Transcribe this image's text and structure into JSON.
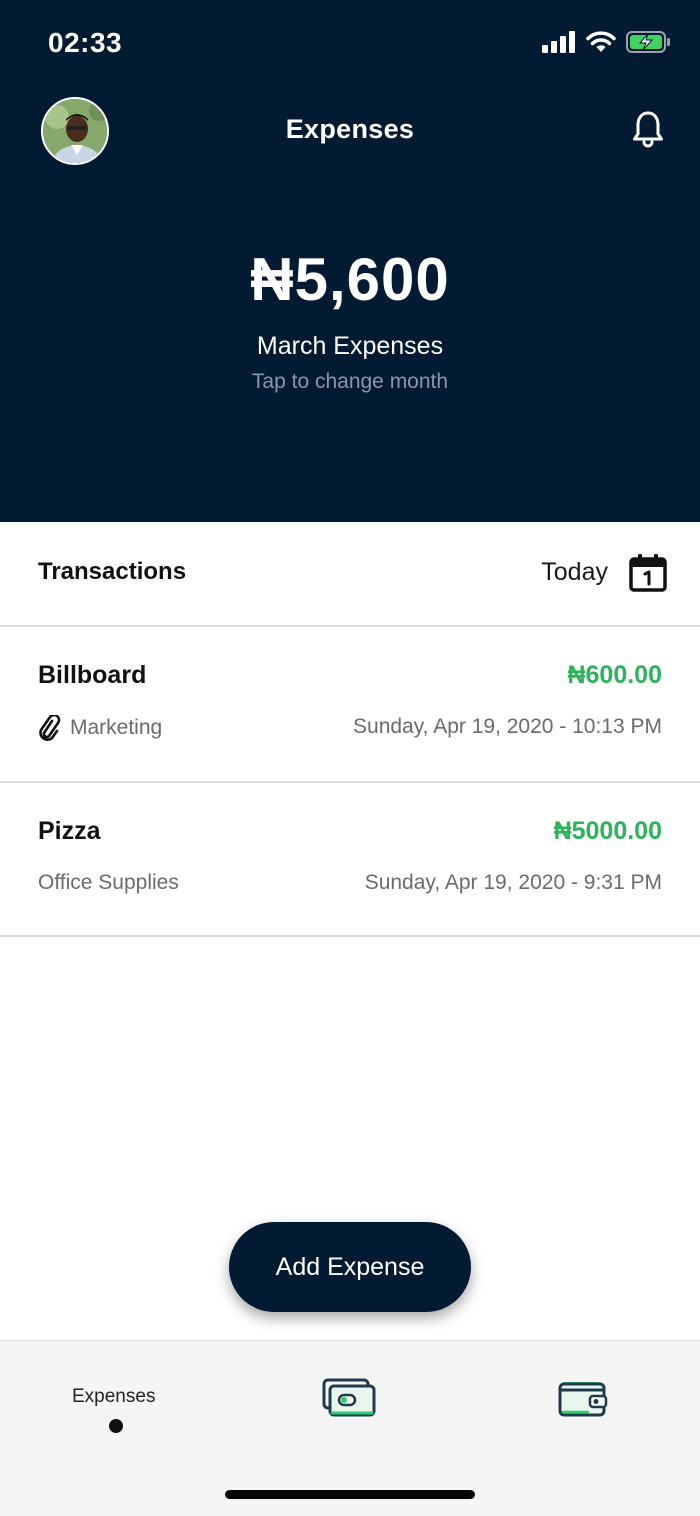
{
  "status_bar": {
    "time": "02:33"
  },
  "header": {
    "title": "Expenses",
    "total": "₦5,600",
    "period_label": "March Expenses",
    "hint": "Tap to change month"
  },
  "transactions": {
    "title": "Transactions",
    "filter": "Today",
    "items": [
      {
        "name": "Billboard",
        "amount": "₦600.00",
        "category": "Marketing",
        "has_attachment": true,
        "date": "Sunday, Apr 19, 2020 - 10:13 PM"
      },
      {
        "name": "Pizza",
        "amount": "₦5000.00",
        "category": "Office Supplies",
        "has_attachment": false,
        "date": "Sunday, Apr 19, 2020 - 9:31 PM"
      }
    ]
  },
  "add_button": {
    "label": "Add Expense"
  },
  "tabbar": {
    "tabs": [
      {
        "label": "Expenses",
        "icon": "expenses-tab",
        "active": true
      },
      {
        "label": "",
        "icon": "cash-icon",
        "active": false
      },
      {
        "label": "",
        "icon": "wallet-icon",
        "active": false
      }
    ]
  },
  "colors": {
    "header_bg": "#031a33",
    "amount_green": "#2bb45a",
    "tabbar_bg": "#f5f5f5"
  }
}
